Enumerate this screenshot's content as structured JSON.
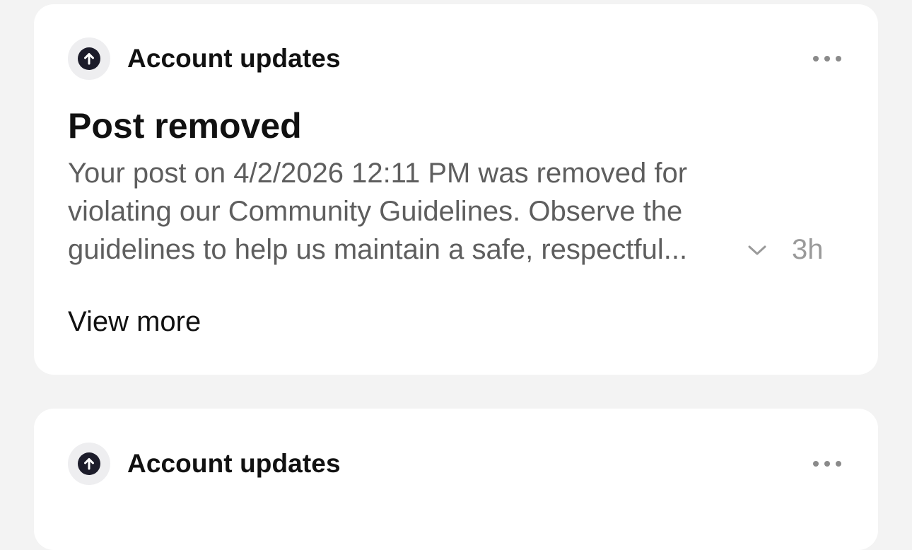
{
  "notifications": [
    {
      "sender": "Account updates",
      "icon": "up-arrow-circle-icon",
      "title": "Post removed",
      "body_lines": [
        "Your post on 4/2/2026 12:11 PM was removed for",
        "violating our Community Guidelines. Observe the",
        "guidelines to help us maintain a safe, respectful..."
      ],
      "time": "3h",
      "view_more_label": "View more"
    },
    {
      "sender": "Account updates",
      "icon": "up-arrow-circle-icon"
    }
  ],
  "colors": {
    "background": "#f3f3f3",
    "card": "#ffffff",
    "title_text": "#111111",
    "body_text": "#5e5e5e",
    "muted_text": "#9a9a9a",
    "icon_bg": "#eeeef0",
    "icon_fg": "#1c1c2a"
  }
}
